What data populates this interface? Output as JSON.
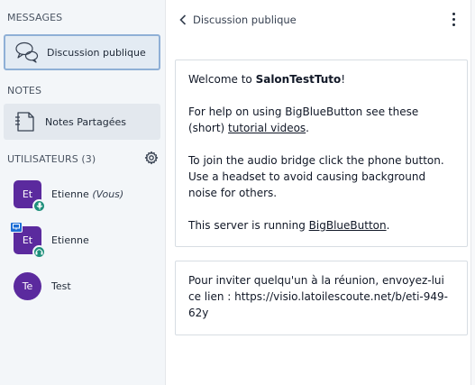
{
  "sidebar": {
    "messages_title": "MESSAGES",
    "public_chat_label": "Discussion publique",
    "notes_title": "NOTES",
    "shared_notes_label": "Notes Partagées",
    "users_title": "UTILISATEURS (3)",
    "users": [
      {
        "initials": "Et",
        "name": "Etienne",
        "suffix": "(Vous)",
        "avatar_shape": "square",
        "badges": [
          "microphone"
        ]
      },
      {
        "initials": "Et",
        "name": "Etienne",
        "suffix": "",
        "avatar_shape": "square",
        "badges": [
          "presenter",
          "listen-only"
        ]
      },
      {
        "initials": "Te",
        "name": "Test",
        "suffix": "",
        "avatar_shape": "round",
        "badges": []
      }
    ]
  },
  "chat": {
    "back_label": "Discussion publique",
    "welcome": {
      "line1_prefix": "Welcome to ",
      "room_name": "SalonTestTuto",
      "line1_suffix": "!",
      "line2_prefix": "For help on using BigBlueButton see these (short) ",
      "tutorial_link": "tutorial videos",
      "line2_suffix": ".",
      "line3": "To join the audio bridge click the phone button. Use a headset to avoid causing background noise for others.",
      "line4_prefix": "This server is running ",
      "server_link": "BigBlueButton",
      "line4_suffix": "."
    },
    "invite": "Pour inviter quelqu'un à la réunion, envoyez-lui ce lien : https://visio.latoilescoute.net/b/eti-949-62y"
  },
  "colors": {
    "sidebar_bg": "#f3f6f9",
    "active_item_border": "#8fb0d6",
    "avatar": "#5b2a9e",
    "audio_badge": "#1e8f7b",
    "presenter_badge": "#1d6fd6"
  }
}
